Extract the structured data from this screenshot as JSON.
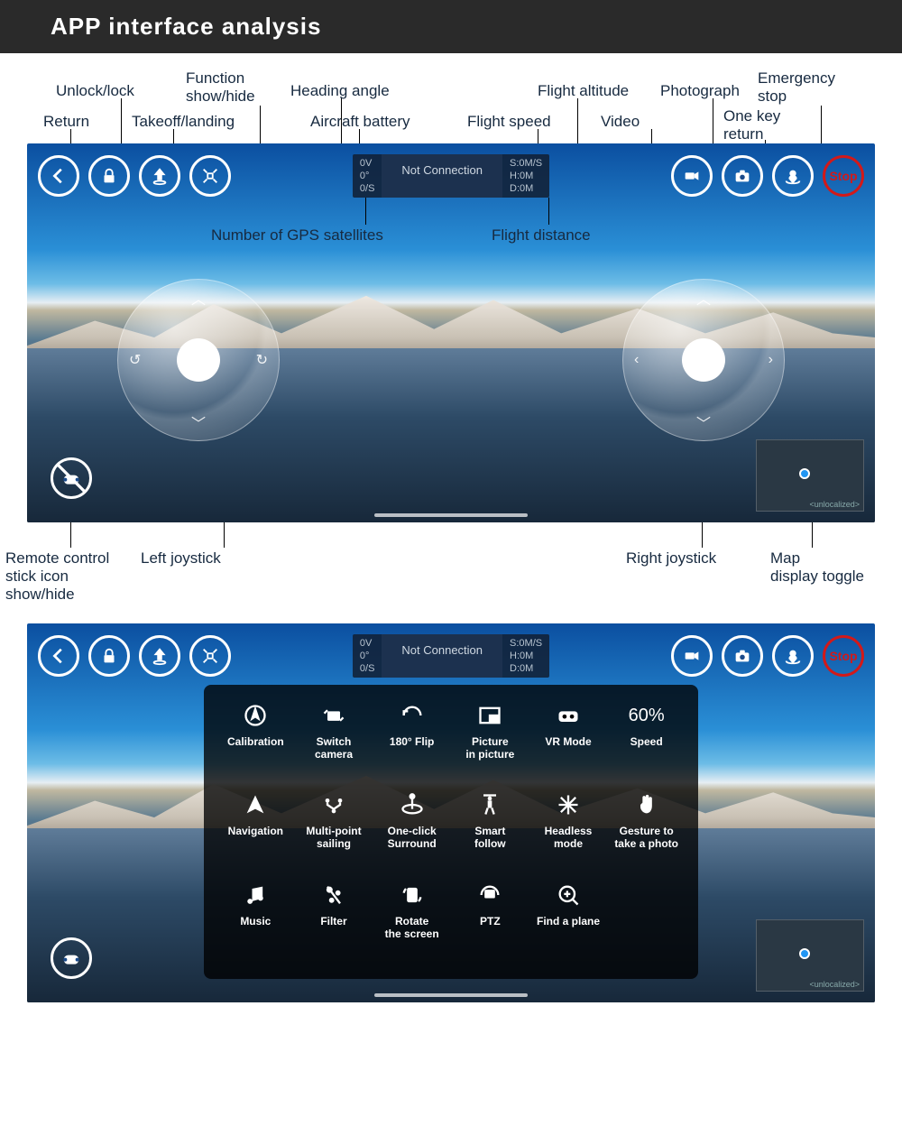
{
  "title": "APP interface analysis",
  "callouts_top": {
    "return": "Return",
    "unlock_lock": "Unlock/lock",
    "takeoff_landing": "Takeoff/landing",
    "function_showhide": "Function\nshow/hide",
    "heading_angle": "Heading angle",
    "aircraft_battery": "Aircraft battery",
    "flight_speed": "Flight speed",
    "flight_altitude": "Flight altitude",
    "video": "Video",
    "photograph": "Photograph",
    "one_key_return": "One key\nreturn",
    "emergency_stop": "Emergency\nstop"
  },
  "callouts_mid": {
    "gps_satellites": "Number of GPS satellites",
    "flight_distance": "Flight distance"
  },
  "callouts_bottom": {
    "remote_stick_showhide": "Remote control\nstick icon\nshow/hide",
    "left_joystick": "Left joystick",
    "right_joystick": "Right joystick",
    "map_toggle": "Map\ndisplay toggle"
  },
  "hud": {
    "battery": "0V",
    "heading": "0°",
    "gps": "0/S",
    "connection": "Not Connection",
    "speed": "S:0M/S",
    "altitude": "H:0M",
    "distance": "D:0M"
  },
  "stop_label": "Stop",
  "minimap_text": "<unlocalized>",
  "func_panel": [
    {
      "label": "Calibration",
      "icon": "compass"
    },
    {
      "label": "Switch\ncamera",
      "icon": "switch-camera"
    },
    {
      "label": "180° Flip",
      "icon": "flip-180"
    },
    {
      "label": "Picture\nin picture",
      "icon": "pip"
    },
    {
      "label": "VR Mode",
      "icon": "vr"
    },
    {
      "label": "Speed",
      "icon": "speed",
      "text": "60%"
    },
    {
      "label": "Navigation",
      "icon": "navigation"
    },
    {
      "label": "Multi-point\nsailing",
      "icon": "multipoint"
    },
    {
      "label": "One-click\nSurround",
      "icon": "surround"
    },
    {
      "label": "Smart\nfollow",
      "icon": "follow"
    },
    {
      "label": "Headless\nmode",
      "icon": "headless"
    },
    {
      "label": "Gesture to\ntake a photo",
      "icon": "gesture"
    },
    {
      "label": "Music",
      "icon": "music"
    },
    {
      "label": "Filter",
      "icon": "filter"
    },
    {
      "label": "Rotate\nthe screen",
      "icon": "rotate"
    },
    {
      "label": "PTZ",
      "icon": "ptz"
    },
    {
      "label": "Find a plane",
      "icon": "findplane"
    }
  ]
}
